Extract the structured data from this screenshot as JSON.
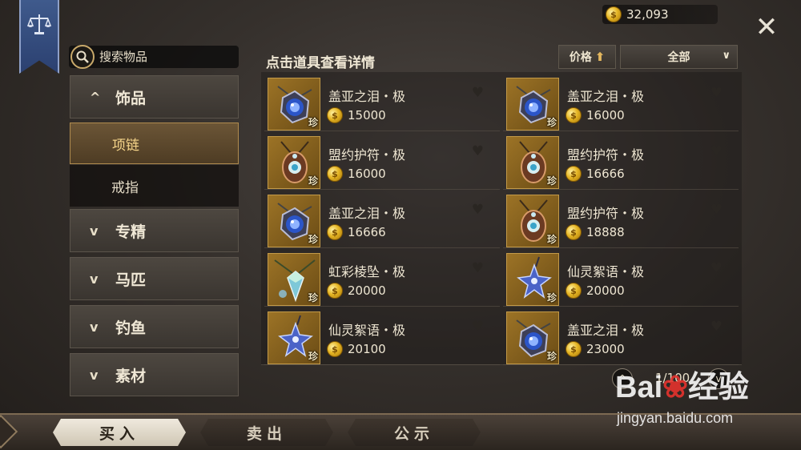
{
  "header": {
    "coins": "32,093",
    "close_symbol": "✕"
  },
  "search": {
    "placeholder": "搜索物品"
  },
  "sidebar": {
    "categories": [
      {
        "label": "饰品",
        "expanded": true,
        "chevron": "^"
      },
      {
        "label": "专精",
        "expanded": false,
        "chevron": "v"
      },
      {
        "label": "马匹",
        "expanded": false,
        "chevron": "v"
      },
      {
        "label": "钓鱼",
        "expanded": false,
        "chevron": "v"
      },
      {
        "label": "素材",
        "expanded": false,
        "chevron": "v"
      }
    ],
    "subitems": [
      {
        "label": "项链",
        "active": true
      },
      {
        "label": "戒指",
        "active": false
      }
    ]
  },
  "list": {
    "hint": "点击道具查看详情",
    "sort_label": "价格",
    "sort_arrow": "⬆",
    "filter_label": "全部",
    "rare_tag": "珍",
    "items": [
      {
        "name": "盖亚之泪・极",
        "price": "15000",
        "icon": "gaia-tear-pendant-icon"
      },
      {
        "name": "盖亚之泪・极",
        "price": "16000",
        "icon": "gaia-tear-pendant-icon"
      },
      {
        "name": "盟约护符・极",
        "price": "16000",
        "icon": "covenant-amulet-icon"
      },
      {
        "name": "盟约护符・极",
        "price": "16666",
        "icon": "covenant-amulet-icon"
      },
      {
        "name": "盖亚之泪・极",
        "price": "16666",
        "icon": "gaia-tear-pendant-icon"
      },
      {
        "name": "盟约护符・极",
        "price": "18888",
        "icon": "covenant-amulet-icon"
      },
      {
        "name": "虹彩棱坠・极",
        "price": "20000",
        "icon": "prism-pendant-icon"
      },
      {
        "name": "仙灵絮语・极",
        "price": "20000",
        "icon": "fairy-star-icon"
      },
      {
        "name": "仙灵絮语・极",
        "price": "20100",
        "icon": "fairy-star-icon"
      },
      {
        "name": "盖亚之泪・极",
        "price": "23000",
        "icon": "gaia-tear-pendant-icon"
      }
    ]
  },
  "pager": {
    "text": "1/100",
    "up": "^",
    "down": "v"
  },
  "tabs": [
    {
      "label": "买入",
      "active": true
    },
    {
      "label": "卖出",
      "active": false
    },
    {
      "label": "公示",
      "active": false
    }
  ],
  "watermark": {
    "logo_left": "Bai",
    "logo_right": "经验",
    "url": "jingyan.baidu.com"
  },
  "colors": {
    "accent_gold": "#e5b524",
    "active_tab_bg": "#efe9dd",
    "banner_blue": "#3f5a8c"
  }
}
